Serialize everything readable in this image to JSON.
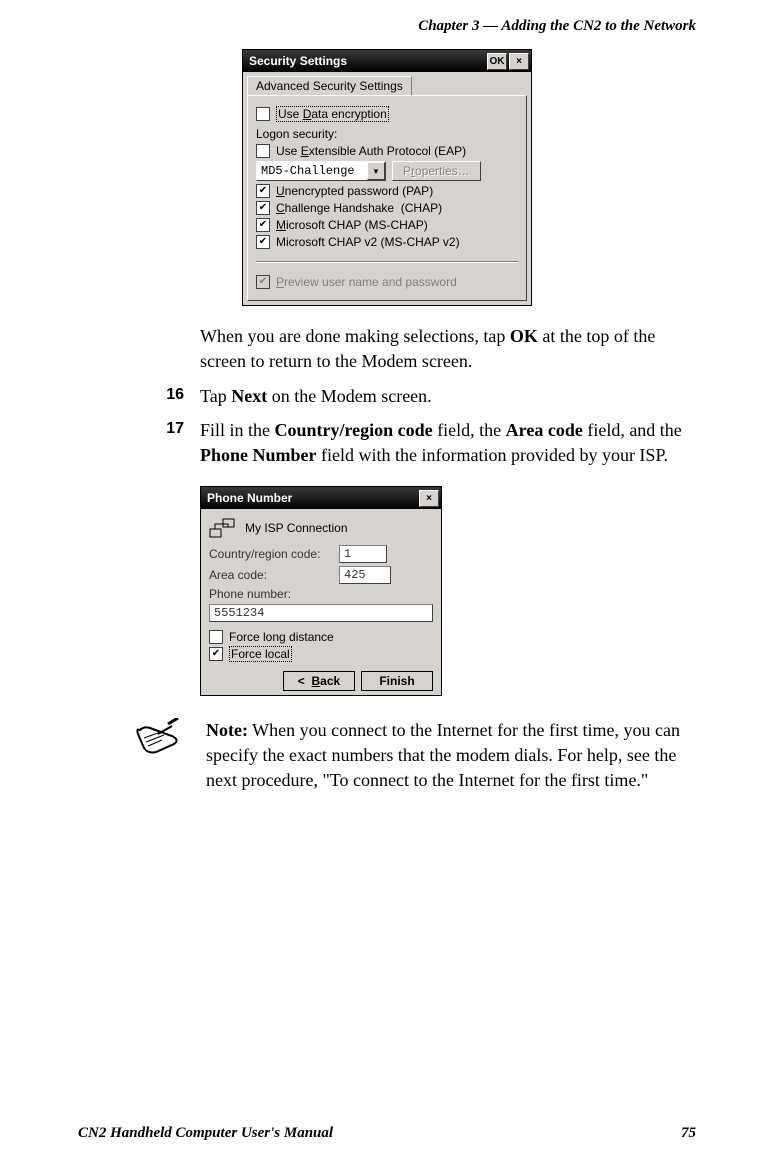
{
  "header": {
    "chapter": "Chapter 3 — Adding the CN2 to the Network"
  },
  "security_dialog": {
    "title": "Security Settings",
    "ok": "OK",
    "close": "×",
    "tab": "Advanced Security Settings",
    "data_encryption": "Use Data encryption",
    "logon_label": "Logon security:",
    "use_eap": "Use Extensible Auth Protocol (EAP)",
    "eap_method": "MD5-Challenge",
    "properties_btn": "Properties…",
    "pap": "Unencrypted password (PAP)",
    "chap": "Challenge Handshake  (CHAP)",
    "mschap": "Microsoft CHAP (MS-CHAP)",
    "mschap2": "Microsoft CHAP v2 (MS-CHAP v2)",
    "preview": "Preview user name and password"
  },
  "para1_a": "When you are done making selections, tap ",
  "para1_bold": "OK",
  "para1_b": " at the top of the screen to return to the Modem screen.",
  "step16": {
    "num": "16",
    "a": "Tap ",
    "bold": "Next",
    "b": " on the Modem screen."
  },
  "step17": {
    "num": "17",
    "a": "Fill in the ",
    "b1": "Country/region code",
    "c": " field, the ",
    "b2": "Area code",
    "d": " field, and the ",
    "b3": "Phone Number",
    "e": " field with the information provided by your ISP."
  },
  "phone_dialog": {
    "title": "Phone Number",
    "close": "×",
    "conn_name": "My ISP Connection",
    "country_label": "Country/region code:",
    "country_val": "1",
    "area_label": "Area code:",
    "area_val": "425",
    "phone_label": "Phone number:",
    "phone_val": "5551234",
    "force_long": "Force long distance",
    "force_local": "Force local",
    "back": "<  Back",
    "finish": "Finish"
  },
  "note": {
    "bold": "Note:",
    "text": " When you connect to the Internet for the first time, you can specify the exact numbers that the modem dials. For help, see the next procedure, \"To connect to the Internet for the first time.\""
  },
  "footer": {
    "left": "CN2 Handheld Computer User's Manual",
    "right": "75"
  }
}
